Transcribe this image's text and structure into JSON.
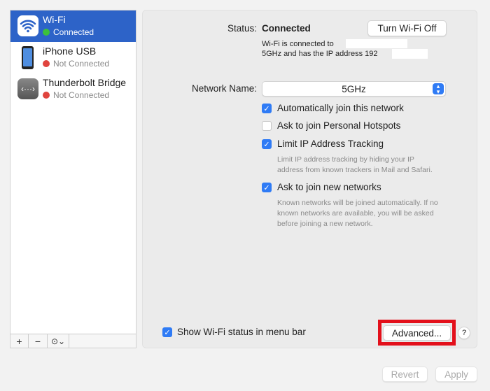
{
  "sidebar": {
    "items": [
      {
        "name": "Wi-Fi",
        "status": "Connected",
        "icon": "wifi-icon",
        "status_color": "#3cc13b"
      },
      {
        "name": "iPhone USB",
        "status": "Not Connected",
        "icon": "iphone-icon",
        "status_color": "#e0443e"
      },
      {
        "name": "Thunderbolt Bridge",
        "status": "Not Connected",
        "icon": "thunderbolt-bridge-icon",
        "status_color": "#e0443e"
      }
    ],
    "toolbar": {
      "add": "+",
      "remove": "−",
      "action": "⊙⌄"
    }
  },
  "panel": {
    "status_label": "Status:",
    "status_value": "Connected",
    "turn_off": "Turn Wi-Fi Off",
    "desc_line1": "Wi-Fi is connected to",
    "desc_line2": "5GHz and has the IP address 192",
    "network_label": "Network Name:",
    "network_value": "5GHz",
    "options": [
      {
        "label": "Automatically join this network",
        "checked": true
      },
      {
        "label": "Ask to join Personal Hotspots",
        "checked": false
      },
      {
        "label": "Limit IP Address Tracking",
        "checked": true,
        "sub": [
          "Limit IP address tracking by hiding your IP",
          "address from known trackers in Mail and Safari."
        ]
      },
      {
        "label": "Ask to join new networks",
        "checked": true,
        "sub": [
          "Known networks will be joined automatically. If no",
          "known networks are available, you will be asked",
          "before joining a new network."
        ]
      }
    ],
    "show_status": "Show Wi-Fi status in menu bar",
    "advanced": "Advanced...",
    "help": "?"
  },
  "footer": {
    "revert": "Revert",
    "apply": "Apply"
  },
  "accent": "#2d63c8"
}
